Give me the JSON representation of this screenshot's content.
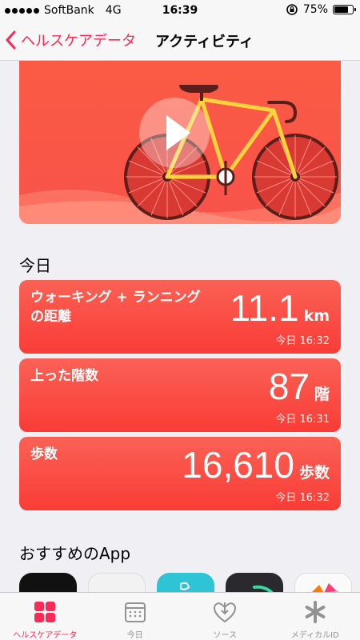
{
  "status_bar": {
    "carrier": "SoftBank",
    "network": "4G",
    "time": "16:39",
    "battery": "75%",
    "battery_level": 0.75
  },
  "nav": {
    "back_label": "ヘルスケアデータ",
    "title": "アクティビティ"
  },
  "sections": {
    "today": "今日",
    "recommended": "おすすめのApp"
  },
  "metrics": [
    {
      "title_line1": "ウォーキング + ランニング",
      "title_line2": "の距離",
      "value": "11.1",
      "unit": "km",
      "time": "今日 16:32"
    },
    {
      "title_line1": "上った階数",
      "title_line2": "",
      "value": "87",
      "unit": "階",
      "time": "今日 16:31"
    },
    {
      "title_line1": "歩数",
      "title_line2": "",
      "value": "16,610",
      "unit": "歩数",
      "time": "今日 16:32"
    }
  ],
  "tabs": [
    {
      "label": "ヘルスケアデータ",
      "icon": "grid-icon",
      "active": true
    },
    {
      "label": "今日",
      "icon": "calendar-icon",
      "active": false
    },
    {
      "label": "ソース",
      "icon": "download-heart-icon",
      "active": false
    },
    {
      "label": "メディカルID",
      "icon": "asterisk-icon",
      "active": false
    }
  ],
  "colors": {
    "accent": "#fa2a57",
    "card": "#f93c36"
  }
}
